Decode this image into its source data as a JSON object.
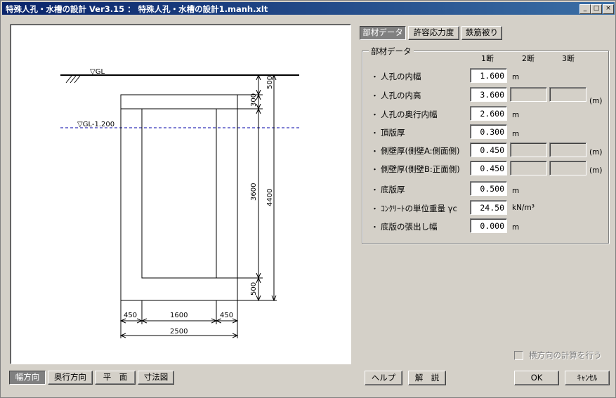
{
  "window": {
    "title": "特殊人孔・水槽の設計 Ver3.15 ： 特殊人孔・水槽の設計1.manh.xlt"
  },
  "title_buttons": {
    "minimize": "_",
    "maximize": "□",
    "close": "×"
  },
  "drawing": {
    "gl_label": "▽GL",
    "water_label": "▽GL-1.200",
    "dims": {
      "top_500": "500",
      "top_300": "300",
      "inner_3600": "3600",
      "total_4400": "4400",
      "bottom_500": "500",
      "w_left": "450",
      "w_inner": "1600",
      "w_right": "450",
      "w_total": "2500"
    }
  },
  "view_tabs": [
    {
      "label": "幅方向",
      "active": true
    },
    {
      "label": "奥行方向",
      "active": false
    },
    {
      "label": "平　面",
      "active": false
    },
    {
      "label": "寸法図",
      "active": false
    }
  ],
  "top_tabs": [
    {
      "label": "部材データ",
      "active": true
    },
    {
      "label": "許容応力度",
      "active": false
    },
    {
      "label": "鉄筋被り",
      "active": false
    }
  ],
  "group": {
    "title": "部材データ",
    "col1": "1断",
    "col2": "2断",
    "col3": "3断",
    "rows": [
      {
        "label": "人孔の内幅",
        "value": "1.600",
        "unit": "m"
      },
      {
        "label": "人孔の内高",
        "value": "3.600",
        "unit": "(m)"
      },
      {
        "label": "人孔の奥行内幅",
        "value": "2.600",
        "unit": "m"
      },
      {
        "label": "頂版厚",
        "value": "0.300",
        "unit": "m"
      },
      {
        "label": "側壁厚(側壁A:側面側)",
        "value": "0.450",
        "unit": "(m)"
      },
      {
        "label": "側壁厚(側壁B:正面側)",
        "value": "0.450",
        "unit": "(m)"
      },
      {
        "label": "底版厚",
        "value": "0.500",
        "unit": "m"
      },
      {
        "label": "ｺﾝｸﾘｰﾄの単位重量 γc",
        "value": "24.50",
        "unit": "kN/m³"
      },
      {
        "label": "底版の張出し幅",
        "value": "0.000",
        "unit": "m"
      }
    ],
    "bullet": "・"
  },
  "checkbox": {
    "label": "横方向の計算を行う",
    "checked": false
  },
  "buttons": {
    "help": "ヘルプ",
    "explain": "解　説",
    "ok": "OK",
    "cancel": "ｷｬﾝｾﾙ"
  }
}
